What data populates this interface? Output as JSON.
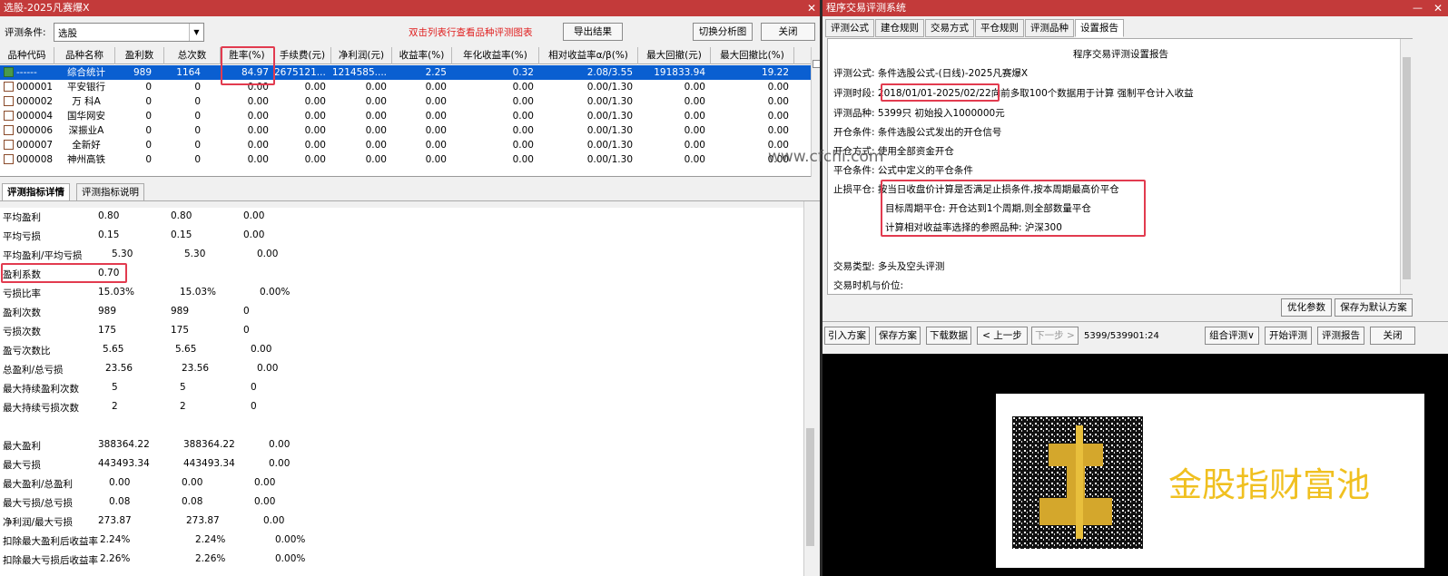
{
  "left_window": {
    "title": "选股-2025凡赛爆X",
    "condition_label": "评测条件:",
    "condition_value": "选股",
    "hint": "双击列表行查看品种评测图表",
    "export_btn": "导出结果",
    "switch_btn": "切换分析图",
    "close_btn": "关闭",
    "columns": [
      "品种代码",
      "品种名称",
      "盈利数",
      "总次数",
      "胜率(%)",
      "手续费(元)",
      "净利润(元)",
      "收益率(%)",
      "年化收益率(%)",
      "相对收益率α/β(%)",
      "最大回撤(元)",
      "最大回撤比(%)"
    ],
    "rows": [
      {
        "code": "------",
        "name": "综合统计",
        "profit_count": "989",
        "total": "1164",
        "win_rate": "84.97",
        "fee": "2675121....",
        "net": "1214585....",
        "return": "2.25",
        "annual": "0.32",
        "relative": "2.08/3.55",
        "max_dd": "191833.94",
        "max_dd_ratio": "19.22",
        "selected": true
      },
      {
        "code": "000001",
        "name": "平安银行",
        "profit_count": "0",
        "total": "0",
        "win_rate": "0.00",
        "fee": "0.00",
        "net": "0.00",
        "return": "0.00",
        "annual": "0.00",
        "relative": "0.00/1.30",
        "max_dd": "0.00",
        "max_dd_ratio": "0.00"
      },
      {
        "code": "000002",
        "name": "万 科A",
        "profit_count": "0",
        "total": "0",
        "win_rate": "0.00",
        "fee": "0.00",
        "net": "0.00",
        "return": "0.00",
        "annual": "0.00",
        "relative": "0.00/1.30",
        "max_dd": "0.00",
        "max_dd_ratio": "0.00"
      },
      {
        "code": "000004",
        "name": "国华网安",
        "profit_count": "0",
        "total": "0",
        "win_rate": "0.00",
        "fee": "0.00",
        "net": "0.00",
        "return": "0.00",
        "annual": "0.00",
        "relative": "0.00/1.30",
        "max_dd": "0.00",
        "max_dd_ratio": "0.00"
      },
      {
        "code": "000006",
        "name": "深振业A",
        "profit_count": "0",
        "total": "0",
        "win_rate": "0.00",
        "fee": "0.00",
        "net": "0.00",
        "return": "0.00",
        "annual": "0.00",
        "relative": "0.00/1.30",
        "max_dd": "0.00",
        "max_dd_ratio": "0.00"
      },
      {
        "code": "000007",
        "name": "全新好",
        "profit_count": "0",
        "total": "0",
        "win_rate": "0.00",
        "fee": "0.00",
        "net": "0.00",
        "return": "0.00",
        "annual": "0.00",
        "relative": "0.00/1.30",
        "max_dd": "0.00",
        "max_dd_ratio": "0.00"
      },
      {
        "code": "000008",
        "name": "神州高铁",
        "profit_count": "0",
        "total": "0",
        "win_rate": "0.00",
        "fee": "0.00",
        "net": "0.00",
        "return": "0.00",
        "annual": "0.00",
        "relative": "0.00/1.30",
        "max_dd": "0.00",
        "max_dd_ratio": "0.00"
      }
    ],
    "tabs": [
      "评测指标详情",
      "评测指标说明"
    ],
    "metrics": [
      {
        "label": "平均盈利",
        "v1": "0.80",
        "v2": "0.80",
        "v3": "0.00"
      },
      {
        "label": "平均亏损",
        "v1": "0.15",
        "v2": "0.15",
        "v3": "0.00"
      },
      {
        "label": "平均盈利/平均亏损",
        "v1": "5.30",
        "v2": "5.30",
        "v3": "0.00"
      },
      {
        "label": "盈利系数",
        "v1": "0.70",
        "v2": "",
        "v3": ""
      },
      {
        "label": "亏损比率",
        "v1": "15.03%",
        "v2": "15.03%",
        "v3": "0.00%"
      },
      {
        "label": "盈利次数",
        "v1": "989",
        "v2": "989",
        "v3": "0"
      },
      {
        "label": "亏损次数",
        "v1": "175",
        "v2": "175",
        "v3": "0"
      },
      {
        "label": "盈亏次数比",
        "v1": "5.65",
        "v2": "5.65",
        "v3": "0.00"
      },
      {
        "label": "总盈利/总亏损",
        "v1": "23.56",
        "v2": "23.56",
        "v3": "0.00"
      },
      {
        "label": "最大持续盈利次数",
        "v1": "5",
        "v2": "5",
        "v3": "0"
      },
      {
        "label": "最大持续亏损次数",
        "v1": "2",
        "v2": "2",
        "v3": "0"
      },
      {
        "label": "",
        "v1": "",
        "v2": "",
        "v3": ""
      },
      {
        "label": "最大盈利",
        "v1": "388364.22",
        "v2": "388364.22",
        "v3": "0.00"
      },
      {
        "label": "最大亏损",
        "v1": "443493.34",
        "v2": "443493.34",
        "v3": "0.00"
      },
      {
        "label": "最大盈利/总盈利",
        "v1": "0.00",
        "v2": "0.00",
        "v3": "0.00"
      },
      {
        "label": "最大亏损/总亏损",
        "v1": "0.08",
        "v2": "0.08",
        "v3": "0.00"
      },
      {
        "label": "净利润/最大亏损",
        "v1": "273.87",
        "v2": "273.87",
        "v3": "0.00"
      },
      {
        "label": "扣除最大盈利后收益率",
        "v1": "2.24%",
        "v2": "2.24%",
        "v3": "0.00%"
      },
      {
        "label": "扣除最大亏损后收益率",
        "v1": "2.26%",
        "v2": "2.26%",
        "v3": "0.00%"
      }
    ]
  },
  "right_window": {
    "title": "程序交易评测系统",
    "tabs": [
      "评测公式",
      "建仓规则",
      "交易方式",
      "平仓规则",
      "评测品种",
      "设置报告"
    ],
    "report_title": "程序交易评测设置报告",
    "lines": {
      "formula_label": "评测公式:",
      "formula": "条件选股公式-(日线)-2025凡赛爆X",
      "period_label": "评测时段:",
      "period": "2018/01/01-2025/02/22",
      "period_suffix": "向前多取100个数据用于计算 强制平仓计入收益",
      "variety_label": "评测品种:",
      "variety": "5399只 初始投入1000000元",
      "open_label": "开仓条件:",
      "open": "条件选股公式发出的开仓信号",
      "mode_label": "开仓方式:",
      "mode": "使用全部资金开仓",
      "close_label": "平仓条件:",
      "close": "公式中定义的平仓条件",
      "stop_label": "止损平仓:",
      "stop1": "按当日收盘价计算是否满足止损条件,按本周期最高价平仓",
      "stop2": "目标周期平仓: 开仓达到1个周期,则全部数量平仓",
      "stop3": "计算相对收益率选择的参照品种: 沪深300",
      "type_label": "交易类型:",
      "type": "多头及空头评测",
      "timing_label": "交易时机与价位:"
    },
    "opt_btn": "优化参数",
    "save_default_btn": "保存为默认方案",
    "bottom_buttons": [
      "引入方案",
      "保存方案",
      "下载数据",
      "< 上一步",
      "下一步 >"
    ],
    "progress": "5399/5399",
    "time": "01:24",
    "bottom_right_buttons": [
      "组合评测∨",
      "开始评测",
      "评测报告",
      "关闭"
    ]
  },
  "watermark": "www.cfchi.com",
  "brand": {
    "text": "金股指财富池",
    "color": "#f0c020"
  }
}
